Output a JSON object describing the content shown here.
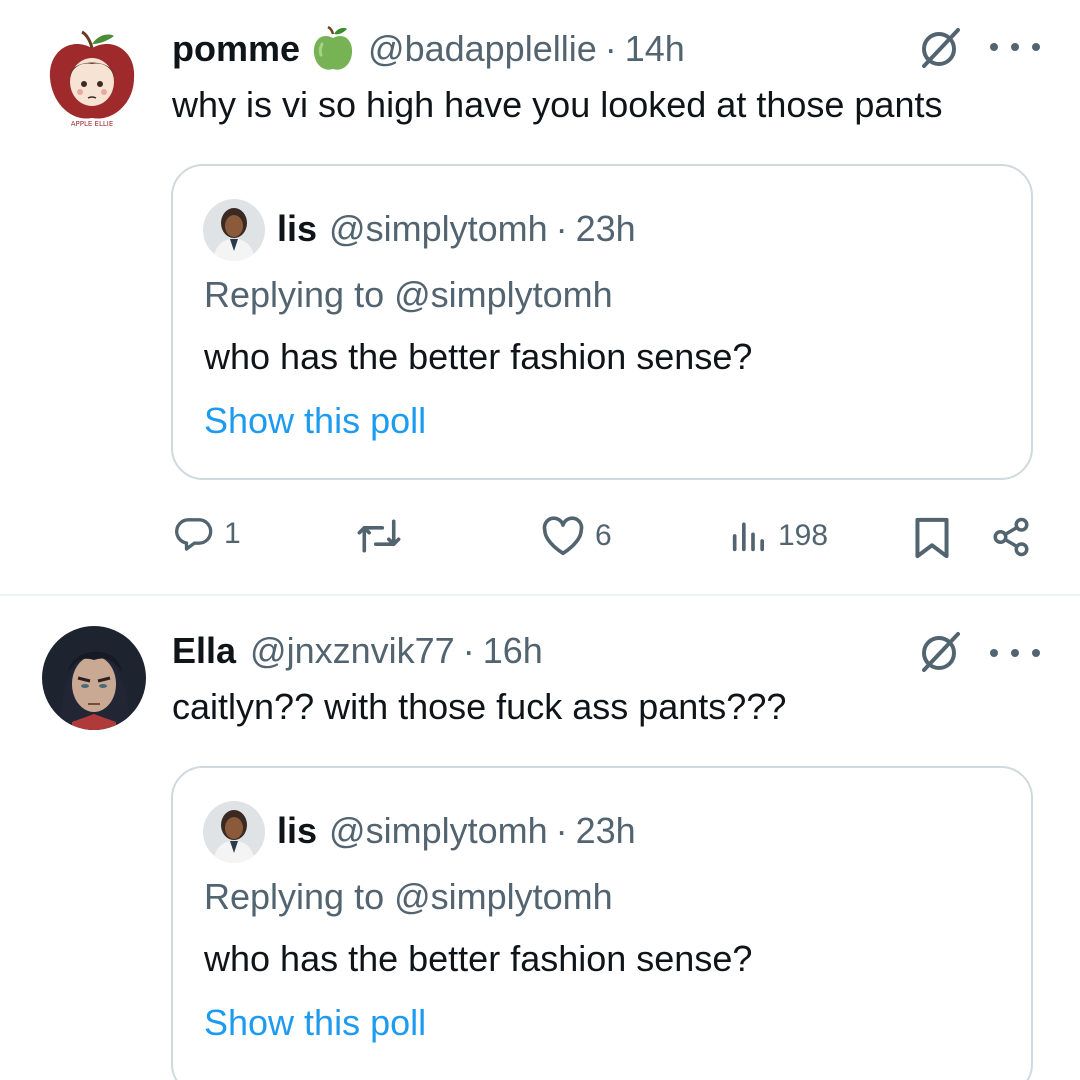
{
  "tweets": [
    {
      "author_name": "pomme",
      "author_emoji": "green-apple",
      "handle": "@badapplellie",
      "separator": "·",
      "time": "14h",
      "text": "why is vi so high have you looked at those pants",
      "quote": {
        "author_name": "lis",
        "handle": "@simplytomh",
        "separator": "·",
        "time": "23h",
        "replying_to": "Replying to @simplytomh",
        "text": "who has the better fashion sense?",
        "poll_link": "Show this poll"
      },
      "actions": {
        "replies": "1",
        "retweets": "",
        "likes": "6",
        "views": "198"
      }
    },
    {
      "author_name": "Ella",
      "handle": "@jnxznvik77",
      "separator": "·",
      "time": "16h",
      "text": "caitlyn?? with those fuck ass pants???",
      "quote": {
        "author_name": "lis",
        "handle": "@simplytomh",
        "separator": "·",
        "time": "23h",
        "replying_to": "Replying to @simplytomh",
        "text": "who has the better fashion sense?",
        "poll_link": "Show this poll"
      }
    }
  ],
  "colors": {
    "text_primary": "#0f1419",
    "text_secondary": "#536471",
    "link": "#1d9bf0",
    "border": "#cfd9de",
    "divider": "#eff3f4"
  },
  "icons": [
    "grok-icon",
    "more-icon",
    "reply-icon",
    "retweet-icon",
    "like-icon",
    "views-icon",
    "bookmark-icon",
    "share-icon",
    "green-apple-emoji"
  ]
}
